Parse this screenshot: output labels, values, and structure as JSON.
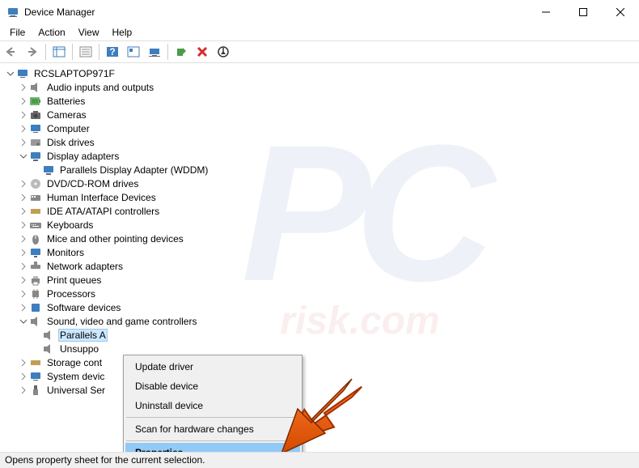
{
  "title": "Device Manager",
  "menu": {
    "file": "File",
    "action": "Action",
    "view": "View",
    "help": "Help"
  },
  "root": "RCSLAPTOP971F",
  "devices": {
    "audio": "Audio inputs and outputs",
    "batteries": "Batteries",
    "cameras": "Cameras",
    "computer": "Computer",
    "disk": "Disk drives",
    "display": "Display adapters",
    "display_child": "Parallels Display Adapter (WDDM)",
    "dvd": "DVD/CD-ROM drives",
    "hid": "Human Interface Devices",
    "ide": "IDE ATA/ATAPI controllers",
    "keyboards": "Keyboards",
    "mice": "Mice and other pointing devices",
    "monitors": "Monitors",
    "network": "Network adapters",
    "printqueues": "Print queues",
    "processors": "Processors",
    "software": "Software devices",
    "sound": "Sound, video and game controllers",
    "sound_child1": "Parallels A",
    "sound_child2": "Unsuppo",
    "storage": "Storage cont",
    "system": "System devic",
    "usb": "Universal Ser"
  },
  "context_menu": {
    "update": "Update driver",
    "disable": "Disable device",
    "uninstall": "Uninstall device",
    "scan": "Scan for hardware changes",
    "properties": "Properties"
  },
  "status": "Opens property sheet for the current selection."
}
